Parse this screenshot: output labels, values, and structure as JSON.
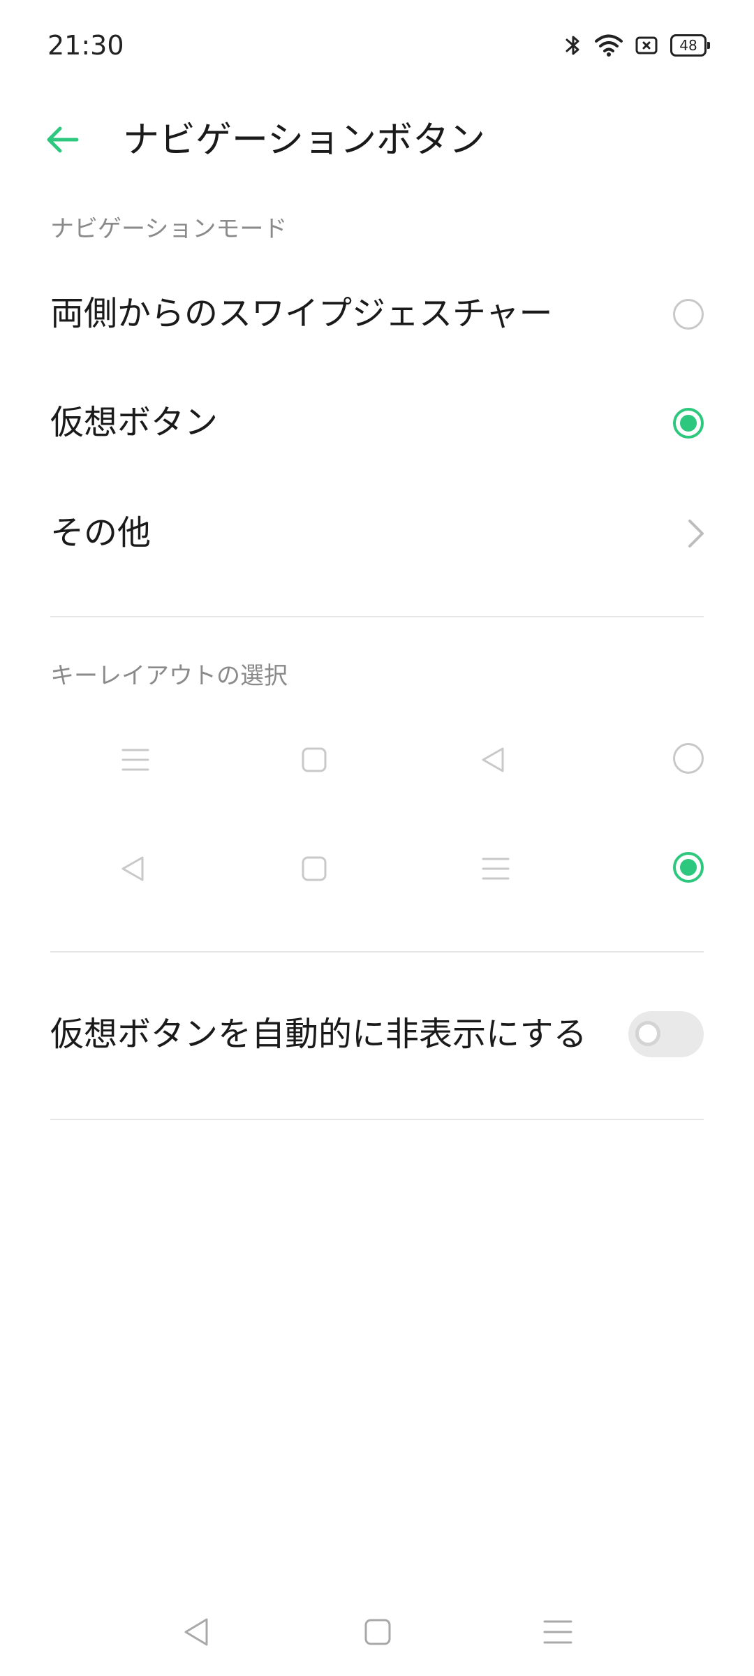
{
  "status_bar": {
    "time": "21:30",
    "battery": "48",
    "icons": [
      "bluetooth-icon",
      "wifi-icon",
      "sim-card-icon",
      "battery-icon"
    ]
  },
  "header": {
    "title": "ナビゲーションボタン",
    "back_icon": "arrow-left-icon"
  },
  "navigation_mode": {
    "section_label": "ナビゲーションモード",
    "options": [
      {
        "label": "両側からのスワイプジェスチャー",
        "selected": false
      },
      {
        "label": "仮想ボタン",
        "selected": true
      }
    ],
    "more_label": "その他"
  },
  "key_layout": {
    "section_label": "キーレイアウトの選択",
    "options": [
      {
        "icons": [
          "menu-icon",
          "home-square-icon",
          "back-triangle-icon"
        ],
        "selected": false
      },
      {
        "icons": [
          "back-triangle-icon",
          "home-square-icon",
          "menu-icon"
        ],
        "selected": true
      }
    ]
  },
  "auto_hide": {
    "label": "仮想ボタンを自動的に非表示にする",
    "enabled": false
  },
  "bottom_nav": {
    "icons": [
      "back-triangle-icon",
      "home-square-icon",
      "menu-icon"
    ]
  },
  "colors": {
    "accent": "#2dc77e",
    "section_text": "#8a8a8a",
    "divider": "#e6e6e6"
  }
}
